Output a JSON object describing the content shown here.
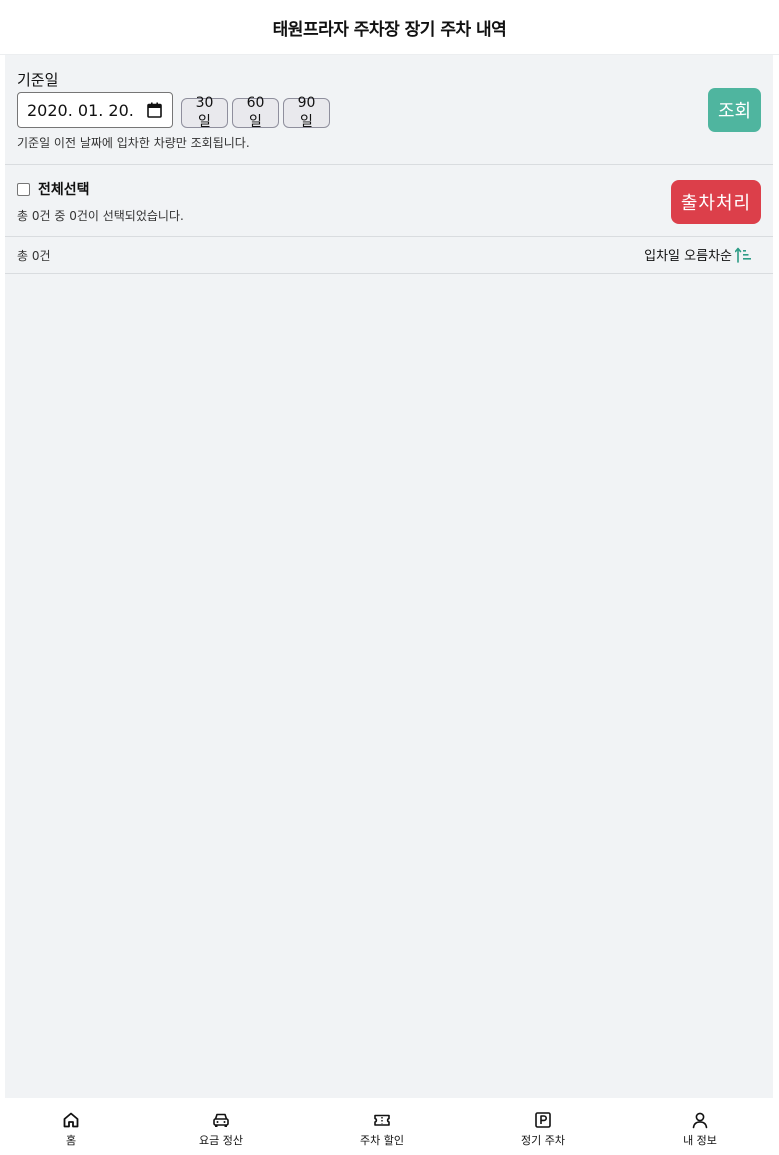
{
  "header": {
    "title": "태원프라자 주차장 장기 주차 내역"
  },
  "filter": {
    "date_label": "기준일",
    "date_value": "2020. 01. 20.",
    "range_buttons": [
      "30일",
      "60일",
      "90일"
    ],
    "search_label": "조회",
    "hint": "기준일 이전 날짜에 입차한 차량만 조회됩니다."
  },
  "selection": {
    "select_all_label": "전체선택",
    "status": "총 0건 중 0건이 선택되었습니다.",
    "exit_label": "출차처리"
  },
  "list": {
    "total": "총 0건",
    "sort_label": "입차일 오름차순",
    "sort_icon": "sort-ascending-icon"
  },
  "nav": {
    "items": [
      {
        "label": "홈",
        "icon": "home-icon"
      },
      {
        "label": "요금 정산",
        "icon": "car-icon"
      },
      {
        "label": "주차 할인",
        "icon": "ticket-icon"
      },
      {
        "label": "정기 주차",
        "icon": "parking-icon"
      },
      {
        "label": "내 정보",
        "icon": "user-icon"
      }
    ]
  },
  "colors": {
    "accent": "#4fb59f",
    "danger": "#dc3f4a",
    "background": "#f1f3f5"
  }
}
